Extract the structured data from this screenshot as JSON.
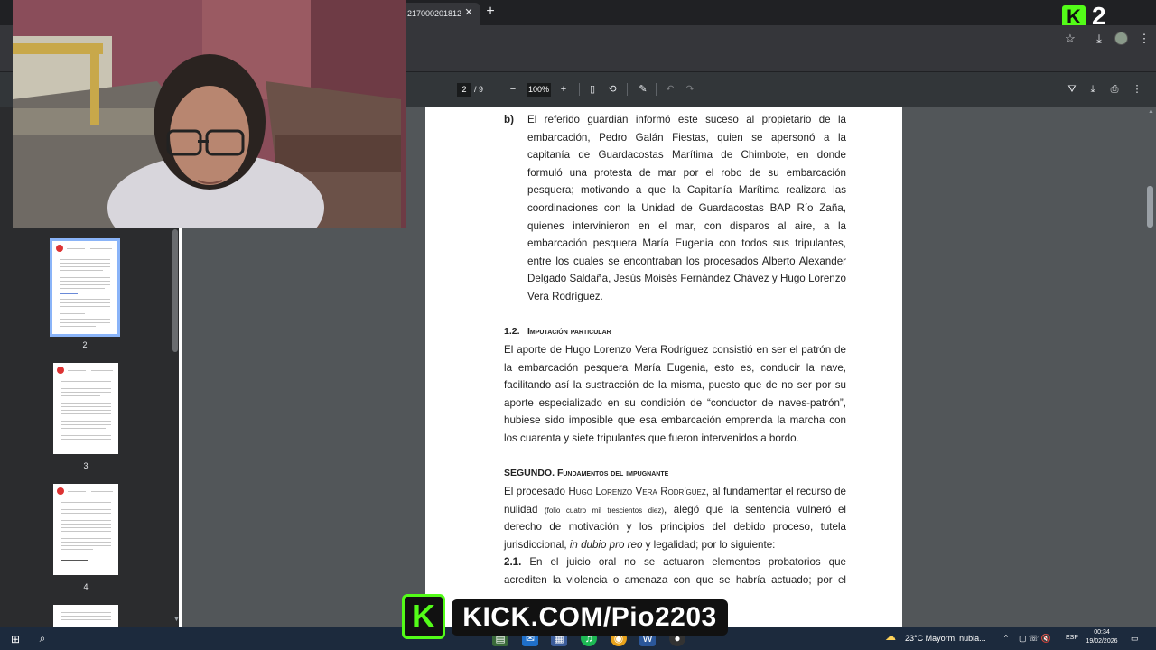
{
  "browser": {
    "tab_title": "217000201812",
    "tab_close": "✕",
    "new_tab": "+",
    "kick_logo": "K",
    "kick_number": "2"
  },
  "pdf_toolbar": {
    "current_page": "2",
    "page_total": "/ 9",
    "zoom": "100%",
    "zoom_out": "−",
    "zoom_in": "+"
  },
  "thumbnails": [
    {
      "label": "2",
      "selected": true
    },
    {
      "label": "3",
      "selected": false
    },
    {
      "label": "4",
      "selected": false
    }
  ],
  "document": {
    "item_b_marker": "b)",
    "item_b_lines": [
      "El referido guardián informó este suceso al propietario de la",
      "embarcación, Pedro Galán Fiestas, quien se apersonó a la",
      "capitanía de Guardacostas Marítima de Chimbote, en donde",
      "formuló una protesta de mar por el robo de su embarcación",
      "pesquera; motivando a que la Capitanía Marítima realizara las",
      "coordinaciones con la Unidad de Guardacostas BAP Río Zaña,",
      "quienes intervinieron en el mar, con disparos al aire, a la",
      "embarcación pesquera María Eugenia con todos sus tripulantes,",
      "entre los cuales se encontraban los procesados Alberto Alexander",
      "Delgado Saldaña, Jesús Moisés Fernández Chávez y Hugo Lorenzo"
    ],
    "item_b_last": "Vera Rodríguez.",
    "section_12_number": "1.2.",
    "section_12_title": "Imputación particular",
    "section_12_lines": [
      "El aporte de Hugo Lorenzo Vera Rodríguez consistió en ser el patrón de",
      "la embarcación pesquera María Eugenia, esto es, conducir la nave,",
      "facilitando así la sustracción de la misma, puesto que de no ser por su",
      "aporte especializado en su condición de “conductor de naves-patrón”,",
      "hubiese sido imposible que esa embarcación emprenda la marcha con"
    ],
    "section_12_last": "los cuarenta y siete tripulantes que fueron intervenidos a bordo.",
    "segundo_heading": "SEGUNDO.",
    "segundo_title": "Fundamentos del impugnante",
    "segundo_line1_pre": "El procesado",
    "segundo_line1_name": "Hugo Lorenzo Vera Rodríguez",
    "segundo_line1_post": ", al fundamentar el recurso de",
    "segundo_line2_pre": "nulidad",
    "segundo_line2_folio": "(folio cuatro mil trescientos diez)",
    "segundo_line2_post": ", alegó que la sentencia vulneró el",
    "segundo_line3": "derecho de motivación y los principios del debido proceso, tutela",
    "segundo_line4_pre": "jurisdiccional,",
    "segundo_line4_italic": "in dubio pro reo",
    "segundo_line4_post": "y legalidad; por lo siguiente:",
    "item_21_number": "2.1.",
    "item_21_line1": "En el juicio oral no se actuaron elementos probatorios que",
    "item_21_line2": "acrediten la violencia o amenaza con que se habría actuado; por el"
  },
  "taskbar": {
    "weather": "23°C  Mayorm. nubla...",
    "language": "ESP",
    "time": "00:34",
    "date": "19/02/2026"
  },
  "overlay": {
    "kick_letter": "K",
    "kick_url": "KICK.COM/Pio2203"
  },
  "colors": {
    "kick_green": "#53fc18",
    "page_bg": "#ffffff",
    "viewer_bg": "#525659",
    "selection_blue": "#8ab4f8"
  }
}
